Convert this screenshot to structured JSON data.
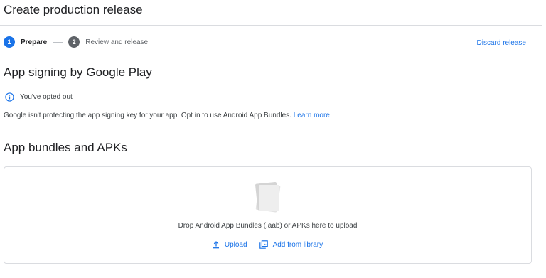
{
  "page": {
    "title": "Create production release"
  },
  "stepper": {
    "steps": [
      {
        "number": "1",
        "label": "Prepare",
        "state": "active"
      },
      {
        "number": "2",
        "label": "Review and release",
        "state": "inactive"
      }
    ],
    "discard_label": "Discard release"
  },
  "signing": {
    "heading": "App signing by Google Play",
    "status_icon": "info-icon",
    "status_text": "You've opted out",
    "description": "Google isn't protecting the app signing key for your app. Opt in to use Android App Bundles.",
    "learn_more": "Learn more"
  },
  "bundles": {
    "heading": "App bundles and APKs",
    "drop_text": "Drop Android App Bundles (.aab) or APKs here to upload",
    "upload_label": "Upload",
    "upload_icon": "upload-icon",
    "library_label": "Add from library",
    "library_icon": "library-icon"
  },
  "colors": {
    "accent": "#1a73e8",
    "text": "#202124",
    "muted": "#5f6368",
    "border": "#dadce0"
  }
}
